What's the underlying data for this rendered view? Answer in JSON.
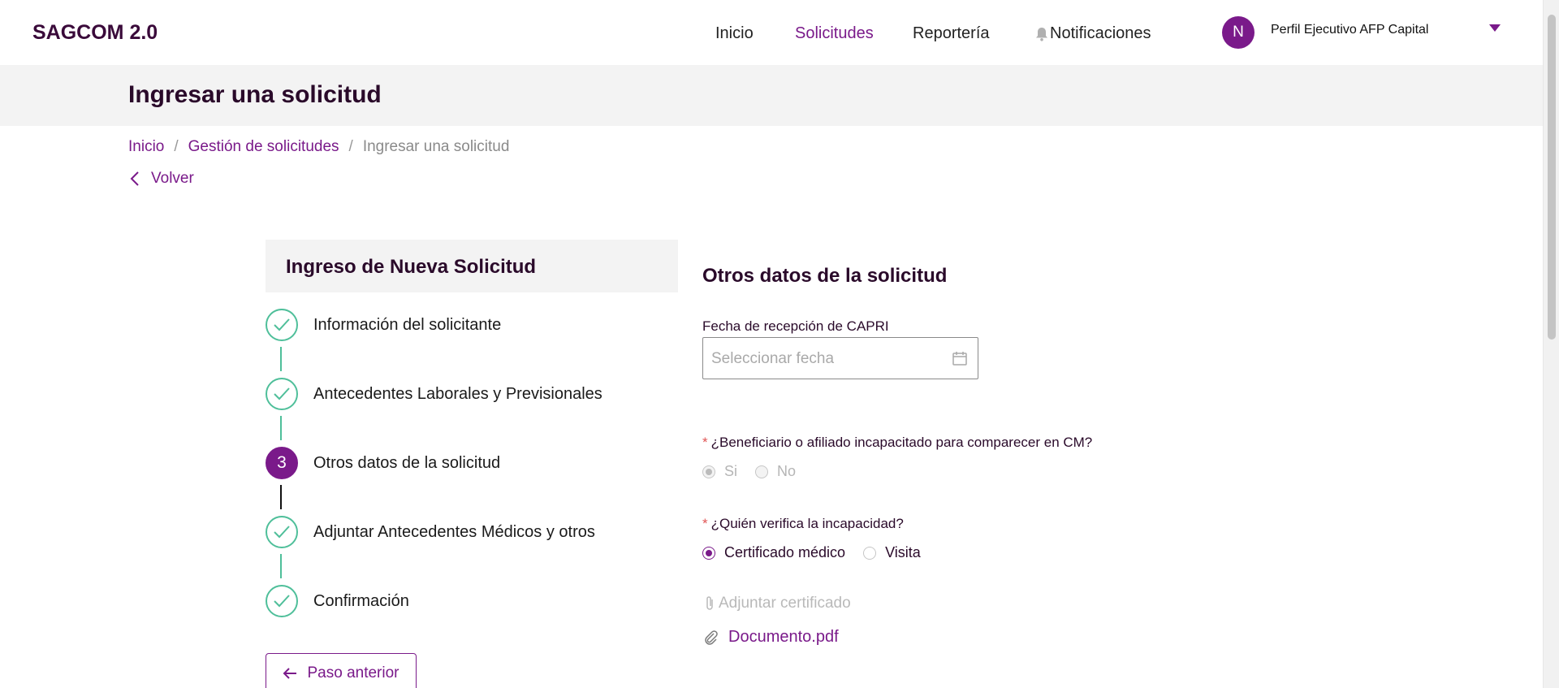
{
  "app": {
    "logo": "SAGCOM 2.0"
  },
  "nav": {
    "inicio": "Inicio",
    "solicitudes": "Solicitudes",
    "reporteria": "Reportería",
    "notificaciones": "Notificaciones"
  },
  "user": {
    "avatar_initial": "N",
    "profile": "Perfil Ejecutivo AFP Capital"
  },
  "header": {
    "title": "Ingresar una solicitud"
  },
  "breadcrumb": {
    "items": [
      "Inicio",
      "Gestión de solicitudes",
      "Ingresar una solicitud"
    ],
    "separator": "/"
  },
  "back_label": "Volver",
  "stepper": {
    "title": "Ingreso de Nueva Solicitud",
    "steps": [
      {
        "label": "Información del solicitante",
        "status": "done"
      },
      {
        "label": "Antecedentes Laborales y Previsionales",
        "status": "done"
      },
      {
        "label": "Otros datos de la solicitud",
        "status": "current",
        "number": "3"
      },
      {
        "label": "Adjuntar Antecedentes Médicos y otros",
        "status": "done"
      },
      {
        "label": "Confirmación",
        "status": "done"
      }
    ],
    "prev_button": "Paso anterior"
  },
  "form": {
    "title": "Otros datos de la solicitud",
    "date_label": "Fecha de recepción de CAPRI",
    "date_placeholder": "Seleccionar fecha",
    "q1": {
      "required_mark": "*",
      "label": "¿Beneficiario o afiliado incapacitado para comparecer en CM?",
      "options": [
        "Si",
        "No"
      ],
      "selected": "Si",
      "disabled": true
    },
    "q2": {
      "required_mark": "*",
      "label": "¿Quién verifica la incapacidad?",
      "options": [
        "Certificado médico",
        "Visita"
      ],
      "selected": "Certificado médico"
    },
    "attach_label": "Adjuntar certificado",
    "file_name": "Documento.pdf"
  },
  "colors": {
    "accent": "#7a1a8a",
    "done": "#4fbf9a",
    "required": "#e05555"
  },
  "icons": [
    "bell-icon",
    "chevron-down-icon",
    "chevron-left-icon",
    "check-icon",
    "calendar-icon",
    "paperclip-icon",
    "arrow-left-icon"
  ]
}
